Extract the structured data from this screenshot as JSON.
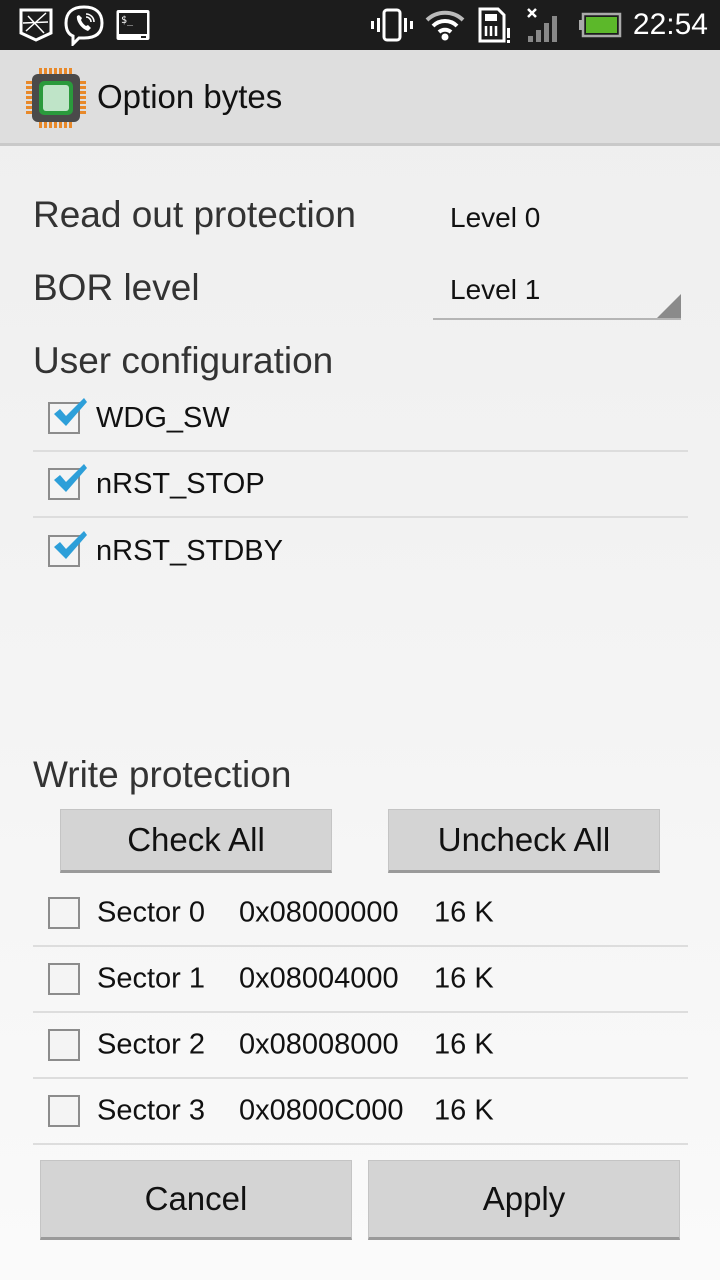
{
  "status_bar": {
    "left_icons": [
      "shield-app-icon",
      "viber-icon",
      "terminal-icon"
    ],
    "right_icons": [
      "vibrate-icon",
      "wifi-icon",
      "sim-card-alert-icon",
      "signal-no-service-icon",
      "battery-icon"
    ],
    "time": "22:54",
    "battery_color": "#5cb82a"
  },
  "action_bar": {
    "title": "Option bytes",
    "icon": "chip-icon"
  },
  "read_out_protection": {
    "label": "Read out protection",
    "value": "Level 0"
  },
  "bor_level": {
    "label": "BOR level",
    "selected": "Level 1"
  },
  "user_configuration": {
    "title": "User configuration",
    "items": [
      {
        "label": "WDG_SW",
        "checked": true
      },
      {
        "label": "nRST_STOP",
        "checked": true
      },
      {
        "label": "nRST_STDBY",
        "checked": true
      }
    ]
  },
  "write_protection": {
    "title": "Write protection",
    "check_all_label": "Check All",
    "uncheck_all_label": "Uncheck All",
    "sectors": [
      {
        "name": "Sector 0",
        "address": "0x08000000",
        "size": "16 K",
        "checked": false
      },
      {
        "name": "Sector 1",
        "address": "0x08004000",
        "size": "16 K",
        "checked": false
      },
      {
        "name": "Sector 2",
        "address": "0x08008000",
        "size": "16 K",
        "checked": false
      },
      {
        "name": "Sector 3",
        "address": "0x0800C000",
        "size": "16 K",
        "checked": false
      }
    ]
  },
  "footer": {
    "cancel_label": "Cancel",
    "apply_label": "Apply"
  },
  "colors": {
    "check_accent": "#2d9fd9",
    "chip_green": "#2a9a3c",
    "chip_pins": "#e8892a"
  }
}
